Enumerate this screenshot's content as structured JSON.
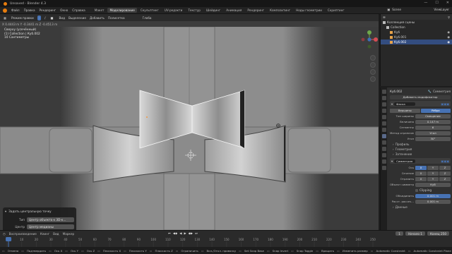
{
  "window": {
    "title": "Unsaved - Blender 4.3"
  },
  "menubar": {
    "menus": [
      "Файл",
      "Правка",
      "Рендеринг",
      "Окно",
      "Справка"
    ],
    "tabs": [
      "Макет",
      "Моделирование",
      "Скульптинг",
      "UV-редакти",
      "Текстур",
      "Шейдинг",
      "Анимация",
      "Рендеринг",
      "Композитинг",
      "Ноды геометрии",
      "Скриптинг"
    ],
    "active_tab": "Моделирование",
    "scene": "Scene",
    "view_layer": "ViewLayer"
  },
  "viewport": {
    "header": {
      "mode": "Режим правки",
      "menus": [
        "Вид",
        "Выделение",
        "Добавить",
        "Полисетка"
      ],
      "transform": "Глоба"
    },
    "info": [
      "Сверху (усечённый)",
      "(1) Collection | Куб.002",
      "10 Сантиметры"
    ],
    "subheader": "X 0.4443 m   Y -0.3441 m   Z -0.4513 m"
  },
  "redo_panel": {
    "title": "Задать центральную точку",
    "rows": [
      {
        "label": "Тип",
        "value": "Центр объекта к 3D-к..."
      },
      {
        "label": "Центр",
        "value": "Центр медианы"
      }
    ]
  },
  "outliner": {
    "header": "Коллекция сцены",
    "items": [
      {
        "label": "Коллекция сцены",
        "indent": 0,
        "selected": false
      },
      {
        "label": "Collection",
        "indent": 1,
        "selected": false
      },
      {
        "label": "Куб",
        "indent": 2,
        "selected": false
      },
      {
        "label": "Куб.001",
        "indent": 2,
        "selected": false
      },
      {
        "label": "Куб.002",
        "indent": 2,
        "selected": true
      }
    ]
  },
  "properties": {
    "object": "Куб.002",
    "modifier_name": "Симметрия",
    "add_modifier": "Добавить модификатор",
    "bevel": {
      "name": "Фаска",
      "mode_tabs": [
        "Вершины",
        "Рёбра"
      ],
      "active_mode": "Рёбра",
      "rows": [
        {
          "label": "Тип ширины",
          "value": "Смещение"
        },
        {
          "label": "Величина",
          "value": "0.147 m"
        },
        {
          "label": "Сегменты",
          "value": "6"
        },
        {
          "label": "Метод ограничен...",
          "value": "Угол"
        },
        {
          "label": "Угол",
          "value": "30°"
        }
      ],
      "subpanels": [
        "Профиль",
        "Геометрия",
        "Затенение"
      ]
    },
    "mirror": {
      "name": "Симметрия",
      "axis_label": "Ось",
      "bisect_label": "Сечение",
      "flip_label": "Отразить",
      "axes": [
        "X",
        "Y",
        "Z"
      ],
      "axis_on": [
        true,
        false,
        false
      ],
      "bisect_on": [
        false,
        false,
        false
      ],
      "flip_on": [
        false,
        false,
        false
      ],
      "mirror_object_label": "Объект симметр...",
      "mirror_object": "Куб",
      "clipping": "Clipping",
      "merge_label": "Объединить",
      "merge_value": "0.001 m",
      "bisect_dist_label": "Расст. рассеч...",
      "bisect_dist_value": "0.001 m",
      "data": "Данные"
    }
  },
  "timeline": {
    "menus": [
      "Воспроизведение",
      "Кеинг",
      "Вид",
      "Маркер"
    ],
    "current_frame": "1",
    "start_label": "Начало",
    "start": "1",
    "end_label": "Конец",
    "end": "250",
    "ticks": [
      "0",
      "10",
      "20",
      "30",
      "40",
      "50",
      "60",
      "70",
      "80",
      "90",
      "100",
      "110",
      "120",
      "130",
      "140",
      "150",
      "160",
      "170",
      "180",
      "190",
      "200",
      "210",
      "220",
      "230",
      "240",
      "250"
    ]
  },
  "statusbar": {
    "items": [
      "Отмена",
      "Подтвердить",
      "Ось X",
      "Ось Y",
      "Ось Z",
      "Плоскость X",
      "Плоскость Y",
      "Плоскость Z",
      "Ограничить",
      "Вкл./Откл. привязку",
      "Set Snap Base",
      "Snap Invert",
      "Snap Toggle",
      "Вращать",
      "Изменить размер",
      "Automatic Constraint",
      "Automatic Constraint Plane",
      "Precision Mode"
    ]
  },
  "colors": {
    "accent": "#4772b3",
    "selection": "#e87d0d",
    "bg": "#3d3d3d"
  }
}
